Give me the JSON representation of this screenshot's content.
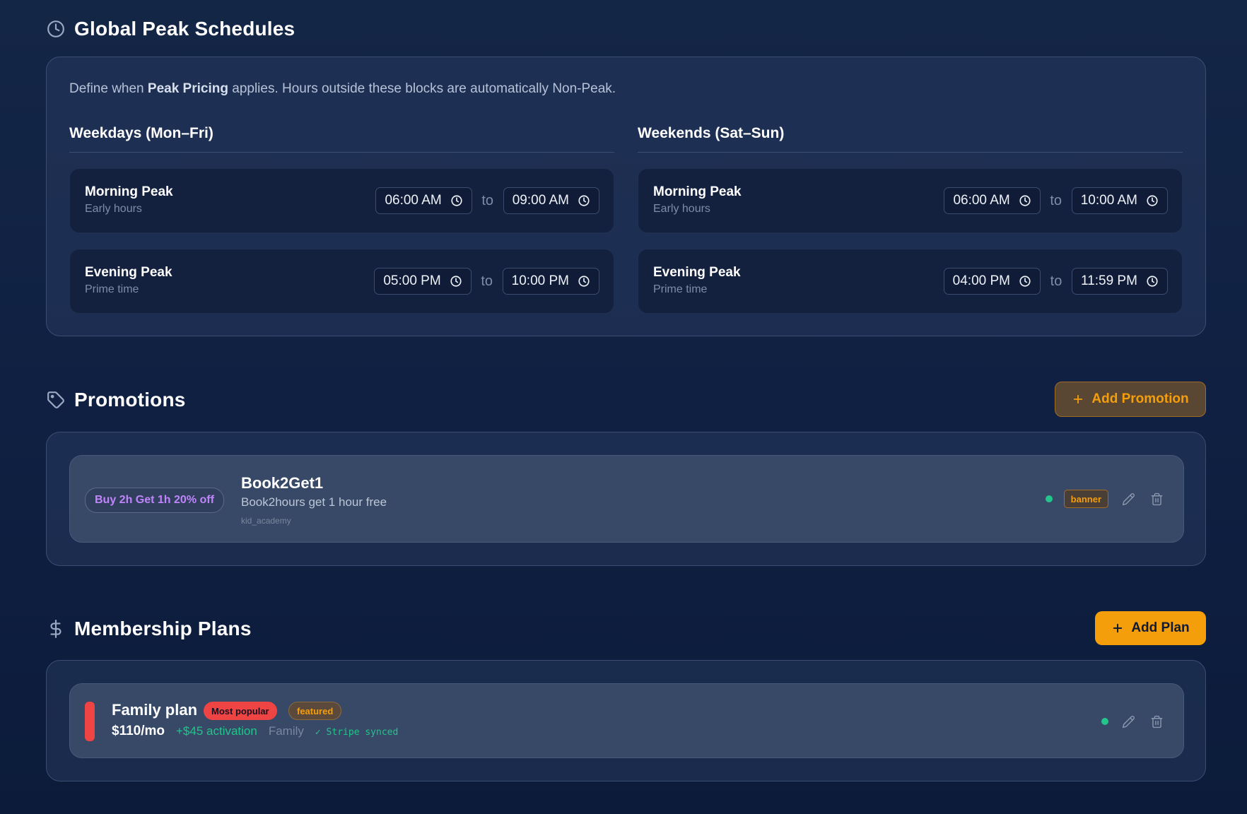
{
  "peak": {
    "title": "Global Peak Schedules",
    "desc_prefix": "Define when ",
    "desc_bold": "Peak Pricing",
    "desc_suffix": " applies. Hours outside these blocks are automatically Non-Peak.",
    "to_label": "to",
    "weekdays": {
      "title": "Weekdays (Mon–Fri)",
      "morning": {
        "name": "Morning Peak",
        "sub": "Early hours",
        "start": "06:00 AM",
        "end": "09:00 AM"
      },
      "evening": {
        "name": "Evening Peak",
        "sub": "Prime time",
        "start": "05:00 PM",
        "end": "10:00 PM"
      }
    },
    "weekends": {
      "title": "Weekends (Sat–Sun)",
      "morning": {
        "name": "Morning Peak",
        "sub": "Early hours",
        "start": "06:00 AM",
        "end": "10:00 AM"
      },
      "evening": {
        "name": "Evening Peak",
        "sub": "Prime time",
        "start": "04:00 PM",
        "end": "11:59 PM"
      }
    }
  },
  "promotions": {
    "title": "Promotions",
    "add_label": "Add Promotion",
    "items": [
      {
        "pill": "Buy 2h Get 1h 20% off",
        "title": "Book2Get1",
        "desc": "Book2hours get 1 hour free",
        "slug": "kid_academy",
        "tag": "banner"
      }
    ]
  },
  "plans": {
    "title": "Membership Plans",
    "add_label": "Add Plan",
    "items": [
      {
        "title": "Family plan",
        "badge_popular": "Most popular",
        "badge_featured": "featured",
        "price": "$110/mo",
        "activation": "+$45 activation",
        "category": "Family",
        "stripe": "✓ Stripe synced"
      }
    ]
  },
  "colors": {
    "accent": "#f59e0b",
    "success": "#22c58b",
    "danger": "#ef4444",
    "promo_pill": "#c084fc"
  }
}
